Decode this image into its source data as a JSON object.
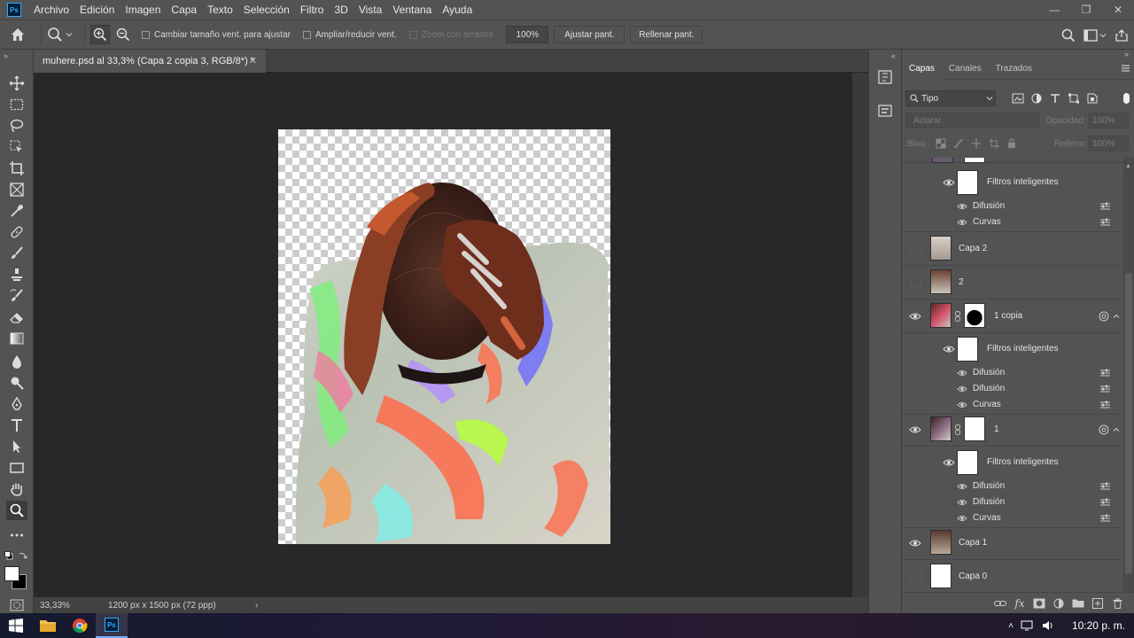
{
  "app": {
    "logo": "Ps"
  },
  "menu": [
    "Archivo",
    "Edición",
    "Imagen",
    "Capa",
    "Texto",
    "Selección",
    "Filtro",
    "3D",
    "Vista",
    "Ventana",
    "Ayuda"
  ],
  "window_controls": {
    "minimize": "—",
    "restore": "❐",
    "close": "✕"
  },
  "options": {
    "resize_windows": "Cambiar tamaño vent. para ajustar",
    "zoom_all": "Ampliar/reducir vent.",
    "scrubby_zoom": "Zoom con arrastre",
    "zoom_value": "100%",
    "fit_screen": "Ajustar pant.",
    "fill_screen": "Rellenar pant."
  },
  "document": {
    "tab_title": "muhere.psd al 33,3% (Capa 2 copia 3, RGB/8*) *",
    "zoom": "33,33%",
    "doc_info": "1200 px x 1500 px (72 ppp)"
  },
  "panel": {
    "tabs": [
      "Capas",
      "Canales",
      "Trazados"
    ],
    "filter_kind": "Tipo",
    "blend_mode": "Aclarar",
    "opacity_label": "Opacidad:",
    "opacity_value": "100%",
    "lock_label": "Bloq.:",
    "fill_label": "Relleno:",
    "fill_value": "100%"
  },
  "layers": [
    {
      "name": "Filtros inteligentes",
      "type": "smartfilter"
    },
    {
      "name": "Difusión",
      "type": "filter"
    },
    {
      "name": "Curvas",
      "type": "filter"
    },
    {
      "name": "Capa 2",
      "type": "layer"
    },
    {
      "name": "2",
      "type": "layer"
    },
    {
      "name": "1 copia",
      "type": "layer"
    },
    {
      "name": "Filtros inteligentes",
      "type": "smartfilter"
    },
    {
      "name": "Difusión",
      "type": "filter"
    },
    {
      "name": "Difusión",
      "type": "filter"
    },
    {
      "name": "Curvas",
      "type": "filter"
    },
    {
      "name": "1",
      "type": "layer"
    },
    {
      "name": "Filtros inteligentes",
      "type": "smartfilter"
    },
    {
      "name": "Difusión",
      "type": "filter"
    },
    {
      "name": "Difusión",
      "type": "filter"
    },
    {
      "name": "Curvas",
      "type": "filter"
    },
    {
      "name": "Capa 1",
      "type": "layer"
    },
    {
      "name": "Capa 0",
      "type": "layer"
    }
  ],
  "taskbar": {
    "clock": "10:20 p. m."
  }
}
